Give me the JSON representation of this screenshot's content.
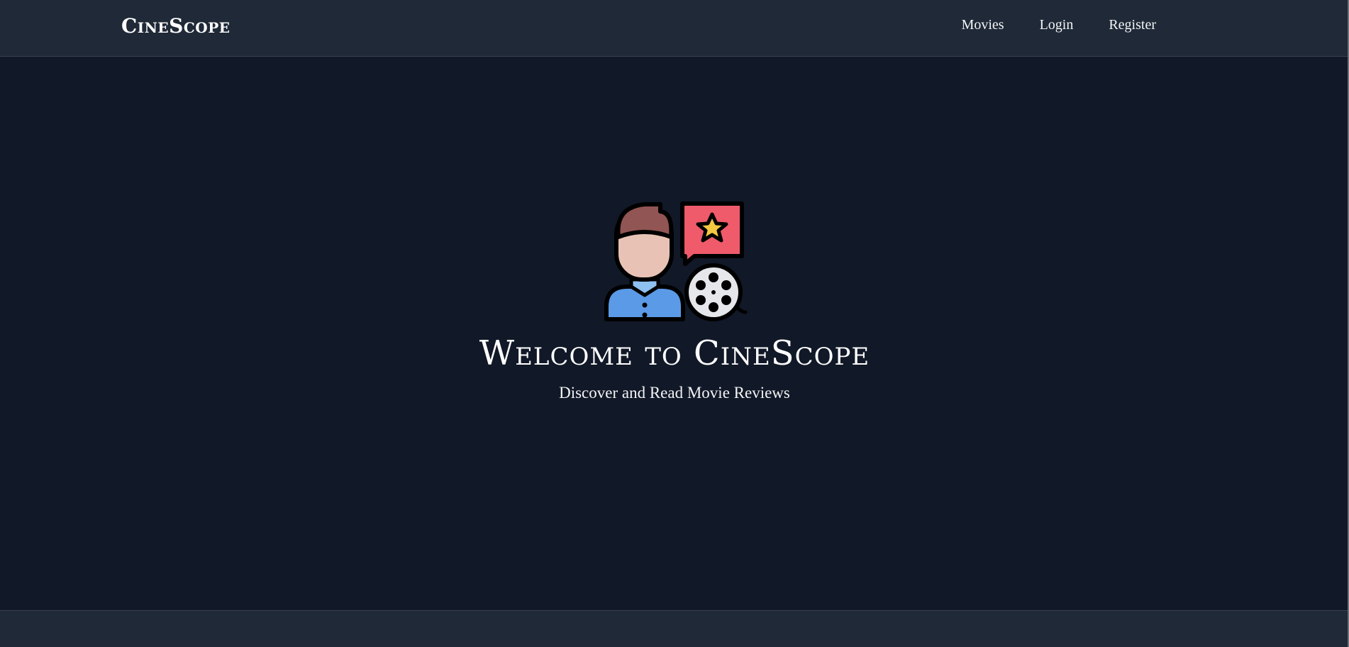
{
  "navbar": {
    "brand": "CineScope",
    "links": [
      {
        "label": "Movies"
      },
      {
        "label": "Login"
      },
      {
        "label": "Register"
      }
    ]
  },
  "hero": {
    "title": "Welcome to CineScope",
    "subtitle": "Discover and Read Movie Reviews",
    "illustration_icons": [
      "user-icon",
      "star-rating-bubble-icon",
      "film-reel-icon"
    ]
  },
  "colors": {
    "background": "#111827",
    "navbar": "#1f2937",
    "text": "#ffffff",
    "bubble": "#ef5b6a",
    "star": "#f5c842",
    "shirt": "#5b9ae6",
    "hair": "#915553",
    "skin": "#e8c3b5"
  }
}
